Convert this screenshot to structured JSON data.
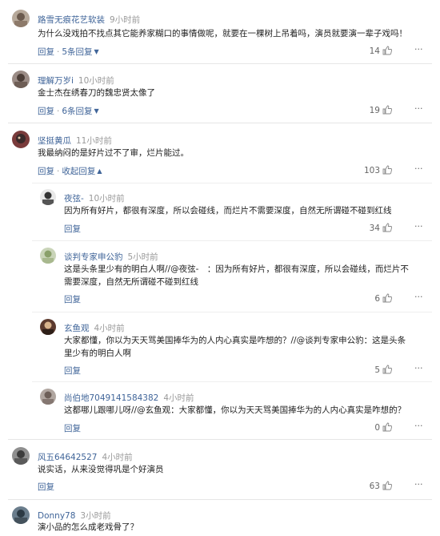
{
  "comments": [
    {
      "user": "路雪无痕花艺软装",
      "time": "9小时前",
      "text": "为什么没戏拍不找点其它能养家糊口的事情做呢，就要在一棵树上吊着吗，演员就要演一辈子戏吗！",
      "reply": "回复",
      "dot": "·",
      "replies": "5条回复",
      "likes": "14"
    },
    {
      "user": "理解万岁i",
      "time": "10小时前",
      "text": "金士杰在绣春刀的魏忠贤太像了",
      "reply": "回复",
      "dot": "·",
      "replies": "6条回复",
      "likes": "19"
    },
    {
      "user": "坚挺黄瓜",
      "time": "11小时前",
      "text": "我最纳闷的是好片过不了审，烂片能过。",
      "reply": "回复",
      "dot": "·",
      "replies": "收起回复",
      "likes": "103",
      "subs": [
        {
          "user": "夜弦-",
          "time": "10小时前",
          "text": "因为所有好片，都很有深度，所以会碰线，而烂片不需要深度，自然无所谓碰不碰到红线",
          "reply": "回复",
          "likes": "34"
        },
        {
          "user": "谈判专家申公豹",
          "time": "5小时前",
          "text_l1": "这是头条里少有的明白人啊//@夜弦-　：因为所有好片，都很有深度，所以会碰线，而烂片不",
          "text_l2": "需要深度，自然无所谓碰不碰到红线",
          "reply": "回复",
          "likes": "6"
        },
        {
          "user": "玄鱼观",
          "time": "4小时前",
          "text_l1": "大家都懂，你以为天天骂美国捧华为的人内心真实是咋想的？//@谈判专家申公豹：这是头条",
          "text_l2": "里少有的明白人啊",
          "reply": "回复",
          "likes": "5"
        },
        {
          "user": "尚伯地7049141584382",
          "time": "4小时前",
          "text": "这都哪儿跟哪儿呀//@玄鱼观：大家都懂，你以为天天骂美国捧华为的人内心真实是咋想的？",
          "reply": "回复",
          "likes": "0"
        }
      ]
    },
    {
      "user": "风五64642527",
      "time": "4小时前",
      "text": "说实话，从来没觉得巩是个好演员",
      "reply": "回复",
      "likes": "63"
    },
    {
      "user": "Donny78",
      "time": "3小时前",
      "text": "演小品的怎么成老戏骨了？"
    }
  ],
  "colors": {
    "name": "#406599",
    "muted": "#999999",
    "text": "#222222"
  },
  "icons": {
    "like": "thumbs-up-icon",
    "more": "more-dots-icon",
    "expand": "chevron-down-icon",
    "collapse": "chevron-up-icon"
  }
}
